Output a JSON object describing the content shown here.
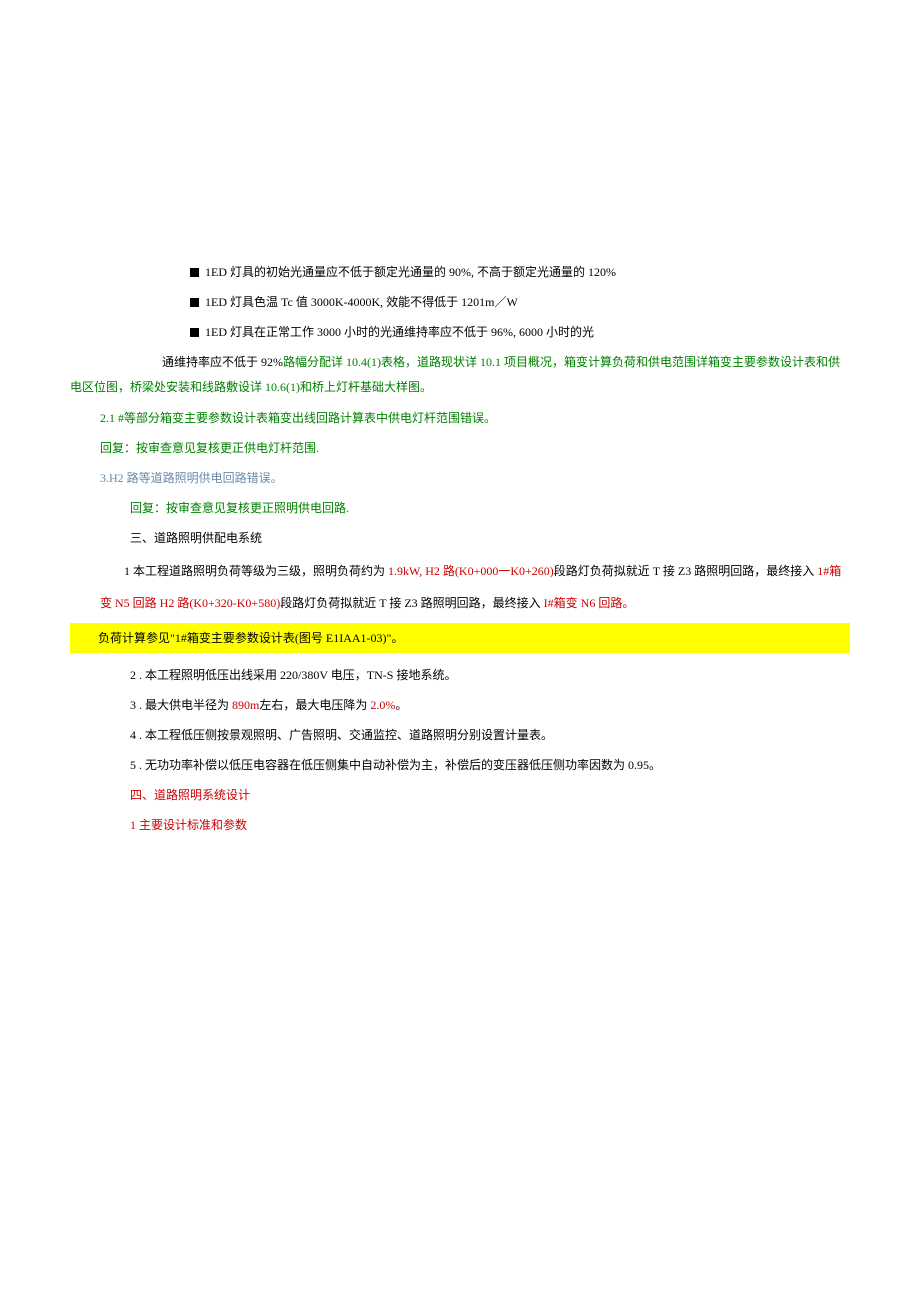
{
  "bullets": [
    "1ED 灯具的初始光通量应不低于额定光通量的 90%, 不高于额定光通量的 120%",
    "1ED 灯具色温 Tc 值 3000K-4000K, 效能不得低于 1201m／W",
    "1ED 灯具在正常工作 3000 小时的光通维持率应不低于 96%, 6000 小时的光"
  ],
  "maintain": {
    "prefix": "通维持率应不低于 92%",
    "green_tail": "路幅分配详 10.4(1)表格，道路现状详 10.1 项目概况，箱变计算负荷和供电范围详箱变主要参数设计表和供电区位图，桥梁处安装和线路敷设详 10.6(1)和桥上灯杆基础大样图。"
  },
  "sec21": "2.1  #等部分箱变主要参数设计表箱变出线回路计算表中供电灯杆范围错误。",
  "reply1": "回复：按审查意见复核更正供电灯杆范围.",
  "sec3": "3.H2 路等道路照明供电回路错误。",
  "reply2": "回复：按审查意见复核更正照明供电回路.",
  "heading3": "三、道路照明供配电系统",
  "p1": {
    "a": "1 本工程道路照明负荷等级为三级，照明负荷约为 ",
    "b": "1.9kW, H2 路(K0+000一K0+260)",
    "c": "段路灯负荷拟就近 T 接 Z3 路照明回路，最终接入 ",
    "d": "1#箱变 N5 回路  H2 路(K0+320-K0+580)",
    "e": "段路灯负荷拟就近 T 接 Z3 路照明回路，最终接入 ",
    "f": "I#箱变 N6 回路",
    "g": "。"
  },
  "hl": "负荷计算参见\"1#箱变主要参数设计表(图号 E1IAA1-03)\"。",
  "items": {
    "i2": "2  . 本工程照明低压出线采用 220/380V 电压，TN-S 接地系统。",
    "i3a": "3  . 最大供电半径为 ",
    "i3b": "890m",
    "i3c": "左右，最大电压降为 ",
    "i3d": "2.0%",
    "i3e": "。",
    "i4": "4  . 本工程低压侧按景观照明、广告照明、交通监控、道路照明分别设置计量表。",
    "i5": "5  . 无功功率补偿以低压电容器在低压侧集中自动补偿为主，补偿后的变压器低压侧功率因数为 0.95。"
  },
  "heading4": "四、道路照明系统设计",
  "sub1": "1 主要设计标准和参数"
}
